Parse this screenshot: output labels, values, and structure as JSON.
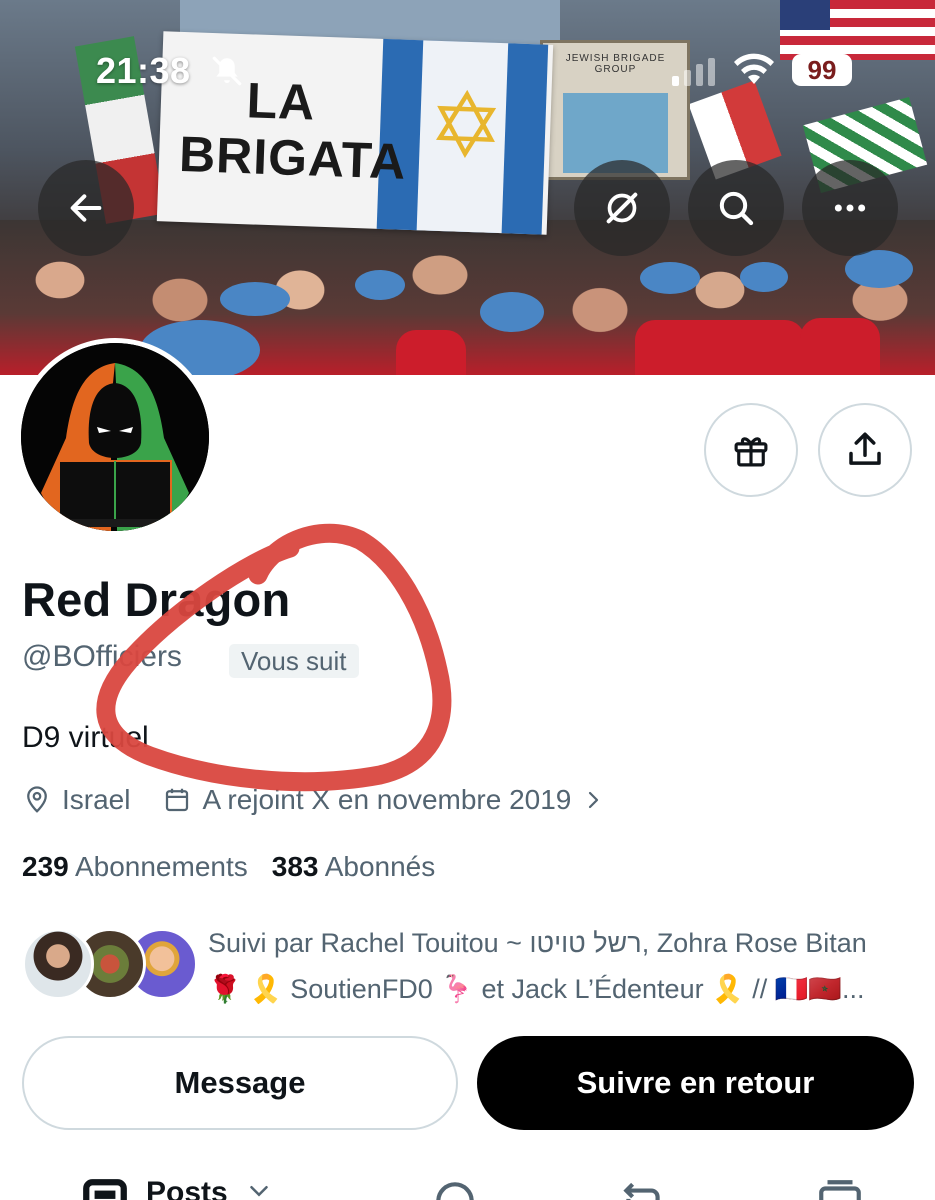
{
  "status_bar": {
    "time": "21:38",
    "battery": "99"
  },
  "banner": {
    "flag_text": "LA BRIGATA",
    "sign_text": "JEWISH BRIGADE GROUP"
  },
  "header": {
    "back_icon": "arrow-left-icon",
    "grok_icon": "grok-icon",
    "search_icon": "search-icon",
    "more_icon": "more-horizontal-icon"
  },
  "profile": {
    "display_name": "Red Dragon",
    "handle": "@BOfficiers",
    "follows_you": "Vous suit",
    "bio": "D9 virtuel",
    "location": "Israel",
    "joined": "A rejoint X en novembre 2019",
    "following_count": "239",
    "following_label": "Abonnements",
    "followers_count": "383",
    "followers_label": "Abonnés",
    "followed_by_line1": "Suivi par Rachel Touitou ~ רשל טויטו, Zohra Rose Bitan",
    "followed_by_line2": "🌹 🎗️ SoutienFD0 🦩 et Jack L’Édenteur 🎗️ // 🇫🇷🇲🇦..."
  },
  "actions": {
    "message_label": "Message",
    "follow_back_label": "Suivre en retour",
    "gift_icon": "gift-icon",
    "share_icon": "share-icon"
  },
  "tabs": {
    "posts_label": "Posts"
  },
  "colors": {
    "annotation": "#d9473f",
    "muted_text": "#536471",
    "primary_text": "#0f1419",
    "border": "#cfd9de"
  }
}
